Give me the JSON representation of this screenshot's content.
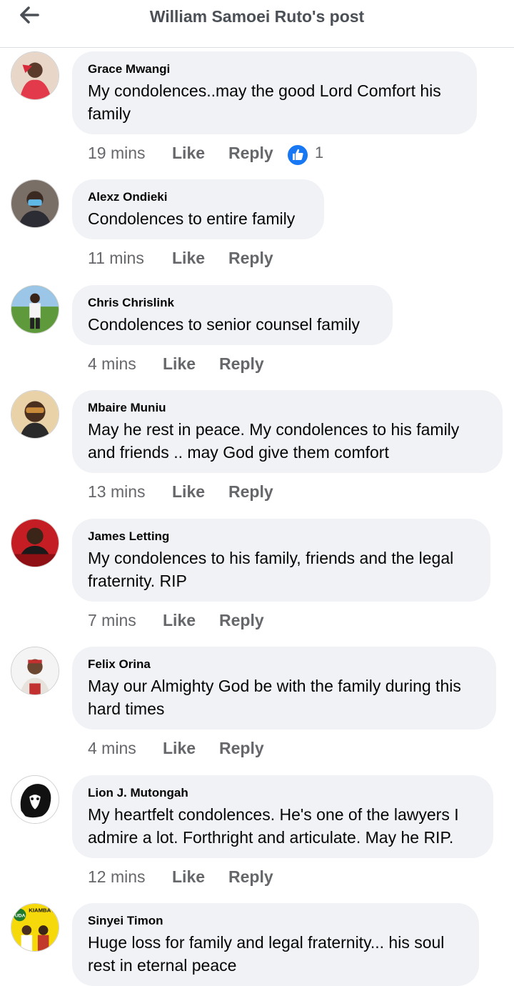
{
  "header": {
    "title": "William Samoei Ruto's post",
    "back_icon": "arrow-left-icon"
  },
  "comments": [
    {
      "author": "Grace Mwangi",
      "text": "My condolences..may the good Lord Comfort his family",
      "time": "19 mins",
      "like_label": "Like",
      "reply_label": "Reply",
      "reaction_count": "1",
      "reaction_icon": "thumbs-up-icon"
    },
    {
      "author": "Alexz Ondieki",
      "text": "Condolences to entire family",
      "time": "11 mins",
      "like_label": "Like",
      "reply_label": "Reply"
    },
    {
      "author": "Chris Chrislink",
      "text": "Condolences to senior counsel family",
      "time": "4 mins",
      "like_label": "Like",
      "reply_label": "Reply"
    },
    {
      "author": "Mbaire Muniu",
      "text": "May he rest in  peace. My condolences to his family and friends .. may God give them comfort",
      "time": "13 mins",
      "like_label": "Like",
      "reply_label": "Reply"
    },
    {
      "author": "James Letting",
      "text": "My condolences to his family, friends and the legal fraternity. RIP",
      "time": "7 mins",
      "like_label": "Like",
      "reply_label": "Reply"
    },
    {
      "author": "Felix Orina",
      "text": "May our Almighty God be with the family during this hard times",
      "time": "4 mins",
      "like_label": "Like",
      "reply_label": "Reply"
    },
    {
      "author": "Lion J. Mutongah",
      "text": "My heartfelt condolences. He's one of the lawyers I admire a lot. Forthright and articulate. May he RIP.",
      "time": "12 mins",
      "like_label": "Like",
      "reply_label": "Reply"
    },
    {
      "author": "Sinyei Timon",
      "text": "Huge loss for family and legal fraternity... his soul rest in eternal peace",
      "avatar_text": "KIAMBA 2021",
      "avatar_badge": "UDA"
    }
  ],
  "colors": {
    "bubble": "#f0f2f5",
    "secondary_text": "#65676b",
    "like_blue": "#1877f2"
  }
}
